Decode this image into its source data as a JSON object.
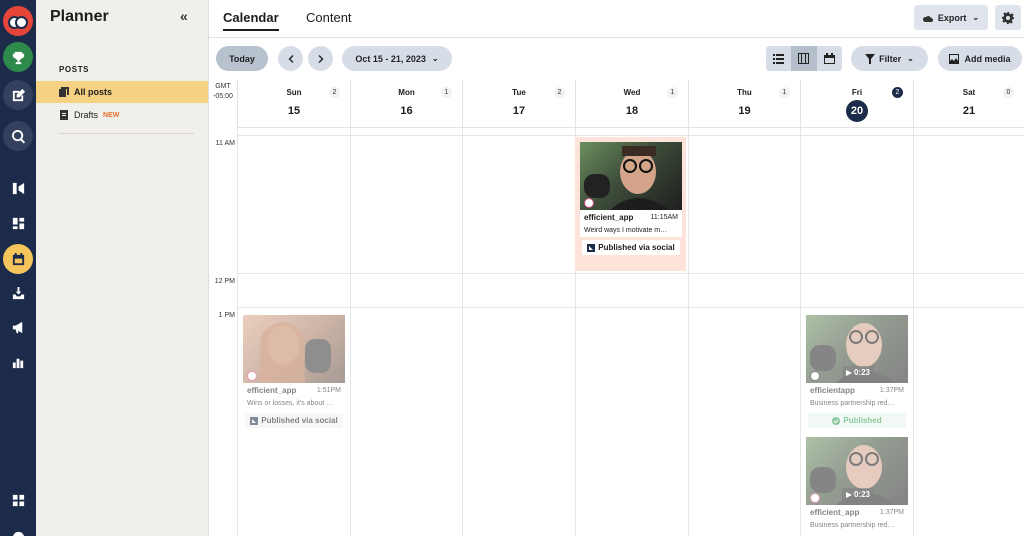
{
  "app": {
    "title": "Planner",
    "collapse_glyph": "«"
  },
  "sidebar": {
    "section": "POSTS",
    "items": [
      {
        "label": "All posts",
        "icon": "stack-icon",
        "active": true
      },
      {
        "label": "Drafts",
        "badge": "NEW",
        "icon": "document-icon",
        "active": false
      }
    ]
  },
  "tabs": [
    {
      "label": "Calendar",
      "active": true
    },
    {
      "label": "Content",
      "active": false
    }
  ],
  "header": {
    "export_label": "Export"
  },
  "toolbar": {
    "today_label": "Today",
    "date_range": "Oct 15 - 21, 2023",
    "filter_label": "Filter",
    "add_media_label": "Add media"
  },
  "calendar": {
    "timezone_line1": "GMT",
    "timezone_line2": "-05:00",
    "days": [
      {
        "name": "Sun",
        "num": "15",
        "count": "2"
      },
      {
        "name": "Mon",
        "num": "16",
        "count": "1"
      },
      {
        "name": "Tue",
        "num": "17",
        "count": "2"
      },
      {
        "name": "Wed",
        "num": "18",
        "count": "1"
      },
      {
        "name": "Thu",
        "num": "19",
        "count": "1"
      },
      {
        "name": "Fri",
        "num": "20",
        "count": "2",
        "today": true
      },
      {
        "name": "Sat",
        "num": "21",
        "count": "0"
      }
    ],
    "hours": [
      "11 AM",
      "12 PM",
      "1 PM"
    ]
  },
  "posts": [
    {
      "account": "efficient_app",
      "time": "11:15AM",
      "desc": "Weird ways I motivate m…",
      "status": "Published via social",
      "network": "instagram",
      "day": "Wed"
    },
    {
      "account": "efficient_app",
      "time": "1:51PM",
      "desc": "Wins or losses, it's about …",
      "status": "Published via social",
      "network": "instagram",
      "day": "Sun"
    },
    {
      "account": "efficientapp",
      "time": "1:37PM",
      "desc": "Business partnership red…",
      "status": "Published",
      "network": "tiktok",
      "duration": "0:23",
      "day": "Fri"
    },
    {
      "account": "efficient_app",
      "time": "1:37PM",
      "desc": "Business partnership red…",
      "network": "instagram",
      "duration": "0:23",
      "day": "Fri"
    }
  ],
  "colors": {
    "rail": "#1c2b4a",
    "sidebar_active": "#f5d182",
    "highlight_card": "#fde3d9",
    "published_green": "#2f9e55"
  }
}
